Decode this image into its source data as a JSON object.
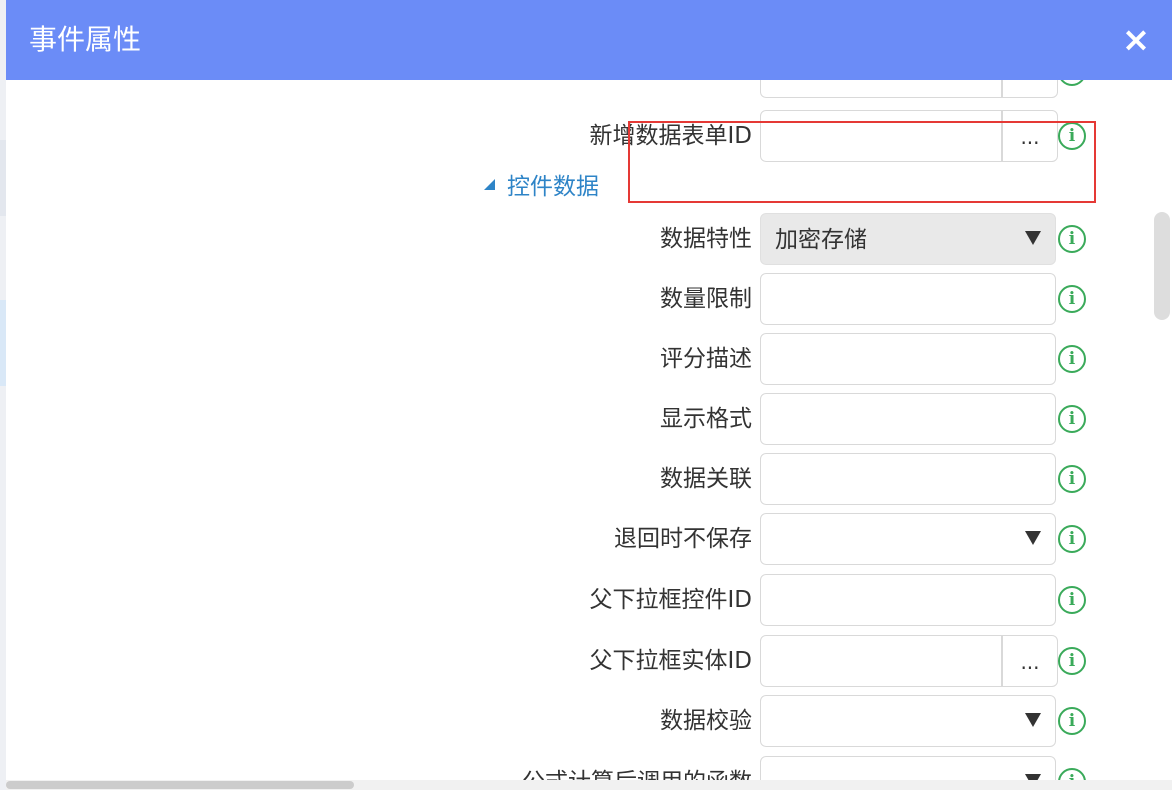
{
  "dialog": {
    "title": "事件属性",
    "close_label": "×"
  },
  "section": {
    "label": "控件数据"
  },
  "ellipsis_label": "...",
  "info_glyph": "i",
  "rows_top": [
    {
      "label": "新增数据表单ID",
      "type": "input-button"
    }
  ],
  "rows": [
    {
      "label": "数据特性",
      "type": "select",
      "value": "加密存储"
    },
    {
      "label": "数量限制",
      "type": "input",
      "value": ""
    },
    {
      "label": "评分描述",
      "type": "input",
      "value": ""
    },
    {
      "label": "显示格式",
      "type": "input",
      "value": ""
    },
    {
      "label": "数据关联",
      "type": "input",
      "value": ""
    },
    {
      "label": "退回时不保存",
      "type": "select",
      "value": ""
    },
    {
      "label": "父下拉框控件ID",
      "type": "input",
      "value": ""
    },
    {
      "label": "父下拉框实体ID",
      "type": "input-button",
      "value": ""
    },
    {
      "label": "数据校验",
      "type": "select",
      "value": ""
    },
    {
      "label": "公式计算后调用的函数",
      "type": "select",
      "value": ""
    }
  ],
  "colors": {
    "header": "#6b8cf7",
    "section": "#2e84c7",
    "info": "#3aaa5a",
    "highlight": "#e53935"
  }
}
